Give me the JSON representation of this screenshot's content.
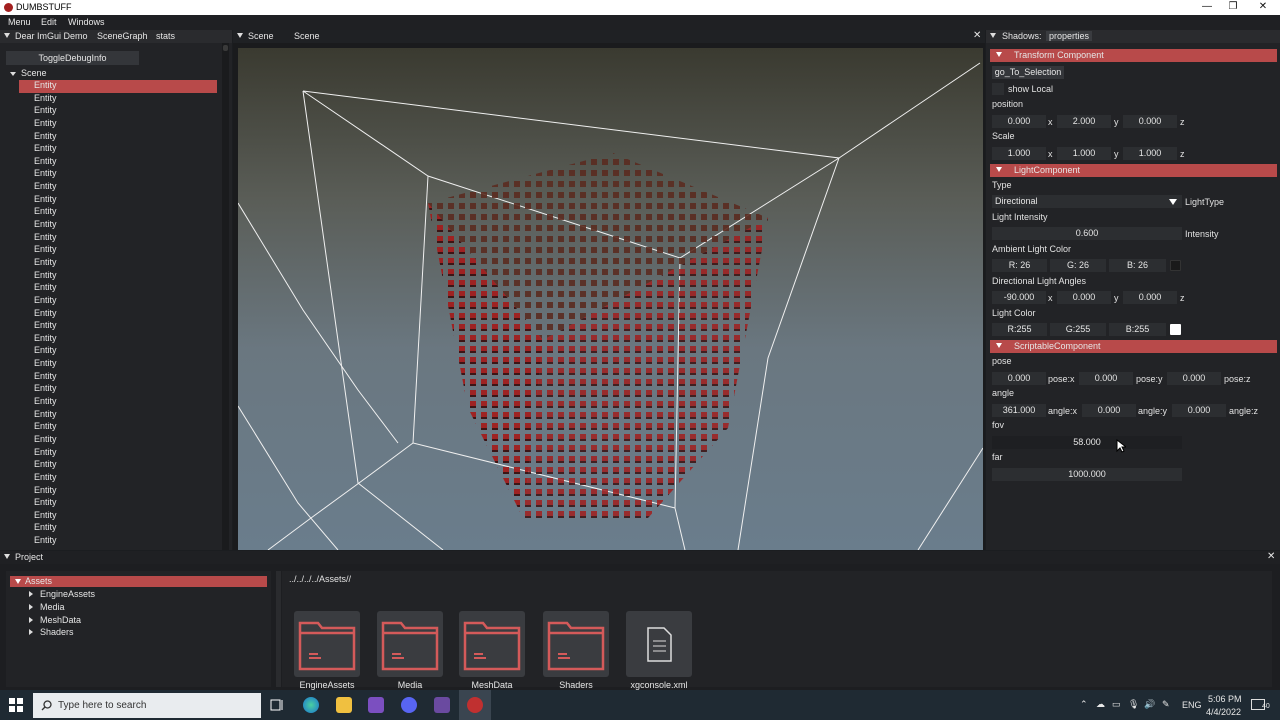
{
  "window": {
    "title": "DUMBSTUFF",
    "minimize": "—",
    "maximize": "❐",
    "close": "✕"
  },
  "menubar": [
    "Menu",
    "Edit",
    "Windows"
  ],
  "left_panel": {
    "tabs": [
      "Dear ImGui Demo",
      "SceneGraph",
      "stats"
    ],
    "toggle_button": "ToggleDebugInfo",
    "root_node": "Scene",
    "entities": [
      "Entity",
      "Entity",
      "Entity",
      "Entity",
      "Entity",
      "Entity",
      "Entity",
      "Entity",
      "Entity",
      "Entity",
      "Entity",
      "Entity",
      "Entity",
      "Entity",
      "Entity",
      "Entity",
      "Entity",
      "Entity",
      "Entity",
      "Entity",
      "Entity",
      "Entity",
      "Entity",
      "Entity",
      "Entity",
      "Entity",
      "Entity",
      "Entity",
      "Entity",
      "Entity",
      "Entity",
      "Entity",
      "Entity",
      "Entity",
      "Entity",
      "Entity",
      "Entity"
    ]
  },
  "scene_panel": {
    "tabs": [
      "Scene",
      "Scene"
    ],
    "close": "✕"
  },
  "right_panel": {
    "tabs": [
      "Shadows:",
      "properties"
    ],
    "transform": {
      "header": "Transform Component",
      "goto_button": "go_To_Selection",
      "show_local": "show Local",
      "position_label": "position",
      "position": [
        "0.000",
        "2.000",
        "0.000"
      ],
      "scale_label": "Scale",
      "scale": [
        "1.000",
        "1.000",
        "1.000"
      ],
      "axes": [
        "x",
        "y",
        "z"
      ]
    },
    "light": {
      "header": "LightComponent",
      "type_label": "Type",
      "type_value": "Directional",
      "type_suffix": "LightType",
      "intensity_label": "Light Intensity",
      "intensity": "0.600",
      "intensity_suffix": "Intensity",
      "ambient_label": "Ambient Light Color",
      "ambient": [
        "R: 26",
        "G: 26",
        "B: 26"
      ],
      "ambient_color": "#1a1a1a",
      "angles_label": "Directional Light Angles",
      "angles": [
        "-90.000",
        "0.000",
        "0.000"
      ],
      "color_label": "Light Color",
      "color": [
        "R:255",
        "G:255",
        "B:255"
      ],
      "light_color": "#ffffff"
    },
    "scriptable": {
      "header": "ScriptableComponent",
      "pose_label": "pose",
      "pose": [
        "0.000",
        "0.000",
        "0.000"
      ],
      "pose_suffixes": [
        "pose:x",
        "pose:y",
        "pose:z"
      ],
      "angle_label": "angle",
      "angle": [
        "361.000",
        "0.000",
        "0.000"
      ],
      "angle_suffixes": [
        "angle:x",
        "angle:y",
        "angle:z"
      ],
      "fov_label": "fov",
      "fov": "58.000",
      "far_label": "far",
      "far": "1000.000"
    }
  },
  "project_panel": {
    "title": "Project",
    "close": "✕",
    "tree_root": "Assets",
    "tree_children": [
      "EngineAssets",
      "Media",
      "MeshData",
      "Shaders"
    ],
    "path": "../../../../Assets//",
    "files": [
      "EngineAssets",
      "Media",
      "MeshData",
      "Shaders",
      "xgconsole.xml"
    ]
  },
  "taskbar": {
    "search_placeholder": "Type here to search",
    "lang": "ENG",
    "time": "5:06 PM",
    "date": "4/4/2022",
    "notifications": "40"
  },
  "colors": {
    "accent": "#b84a4a",
    "folder_stroke": "#d45a5a"
  }
}
